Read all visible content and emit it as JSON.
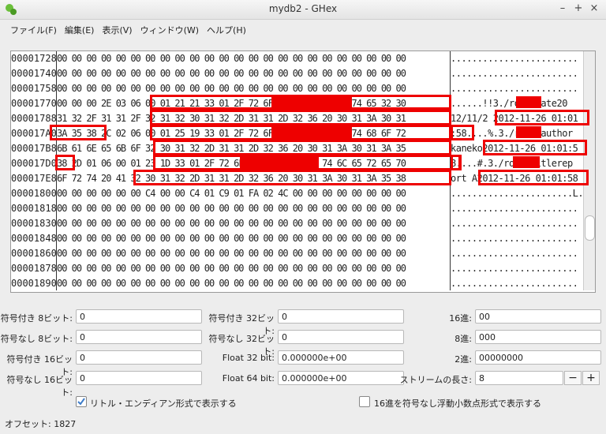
{
  "window": {
    "title": "mydb2 - GHex",
    "controls": [
      "–",
      "+",
      "×"
    ]
  },
  "menu": [
    "ファイル(F)",
    "編集(E)",
    "表示(V)",
    "ウィンドウ(W)",
    "ヘルプ(H)"
  ],
  "hex": {
    "offsets": [
      "00001728",
      "00001740",
      "00001758",
      "00001770",
      "00001788",
      "000017A0",
      "000017B8",
      "000017D0",
      "000017E8",
      "00001800",
      "00001818",
      "00001830",
      "00001848",
      "00001860",
      "00001878",
      "00001890"
    ],
    "rows": [
      "00 00 00 00 00 00 00 00 00 00 00 00 00 00 00 00 00 00 00 00 00 00 00 00",
      "00 00 00 00 00 00 00 00 00 00 00 00 00 00 00 00 00 00 00 00 00 00 00 00",
      "00 00 00 00 00 00 00 00 00 00 00 00 00 00 00 00 00 00 00 00 00 00 00 00",
      "00 00 00 2E 03 06 00 01 21 21 33 01 2F 72 6F 6F 74 2F 64 61 74 65 32 30",
      "31 32 2F 31 31 2F 32 31 32 30 31 32 2D 31 31 2D 32 36 20 30 31 3A 30 31",
      "3A 35 38 2C 02 06 00 01 25 19 33 01 2F 72 6F 6F 74 2F 61 75 74 68 6F 72",
      "6B 61 6E 65 6B 6F 32 30 31 32 2D 31 31 2D 32 36 20 30 31 3A 30 31 3A 35",
      "38 2D 01 06 00 01 23 1D 33 01 2F 72 6F 6F 74 2F 74 69 74 6C 65 72 65 70",
      "6F 72 74 20 41 32 30 31 32 2D 31 31 2D 32 36 20 30 31 3A 30 31 3A 35 38",
      "00 00 00 00 00 00 C4 00 00 C4 01 C9 01 FA 02 4C 00 00 00 00 00 00 00 00",
      "00 00 00 00 00 00 00 00 00 00 00 00 00 00 00 00 00 00 00 00 00 00 00 00",
      "00 00 00 00 00 00 00 00 00 00 00 00 00 00 00 00 00 00 00 00 00 00 00 00",
      "00 00 00 00 00 00 00 00 00 00 00 00 00 00 00 00 00 00 00 00 00 00 00 00",
      "00 00 00 00 00 00 00 00 00 00 00 00 00 00 00 00 00 00 00 00 00 00 00 00",
      "00 00 00 00 00 00 00 00 00 00 00 00 00 00 00 00 00 00 00 00 00 00 00 00",
      "00 00 00 00 00 00 00 00 00 00 00 00 00 00 00 00 00 00 00 00 00 00 00 00"
    ],
    "ascii": [
      "........................",
      "........................",
      "........................",
      "......!!3./root/date20",
      "12/11/2 2012-11-26 01:01",
      ":58....%.3./root/author",
      "kaneko2012-11-26 01:01:5",
      "8....#.3./root/titlerep",
      "ort A2012-11-26 01:01:58",
      ".......................L.",
      "........................",
      "........................",
      "........................",
      "........................",
      "........................",
      "........................"
    ]
  },
  "converter": {
    "s8_label": "符号付き 8ビット:",
    "s8": "0",
    "u8_label": "符号なし 8ビット:",
    "u8": "0",
    "s16_label": "符号付き 16ビット:",
    "s16": "0",
    "u16_label": "符号なし 16ビット:",
    "u16": "0",
    "s32_label": "符号付き 32ビット:",
    "s32": "0",
    "u32_label": "符号なし 32ビット:",
    "u32": "0",
    "f32_label": "Float 32 bit:",
    "f32": "0.000000e+00",
    "f64_label": "Float 64 bit:",
    "f64": "0.000000e+00",
    "hex_label": "16進:",
    "hex": "00",
    "oct_label": "8進:",
    "oct": "000",
    "bin_label": "2進:",
    "bin": "00000000",
    "stream_label": "ストリームの長さ:",
    "stream": "8",
    "minus": "−",
    "plus": "+",
    "little_endian_label": "リトル・エンディアン形式で表示する",
    "little_endian": true,
    "unsigned_float_label": "16進を符号なし浮動小数点形式で表示する",
    "unsigned_float": false
  },
  "status": {
    "offset": "オフセット: 1827"
  },
  "colors": {
    "highlight": "#ee0000",
    "accent_check": "#3d7cc9"
  }
}
